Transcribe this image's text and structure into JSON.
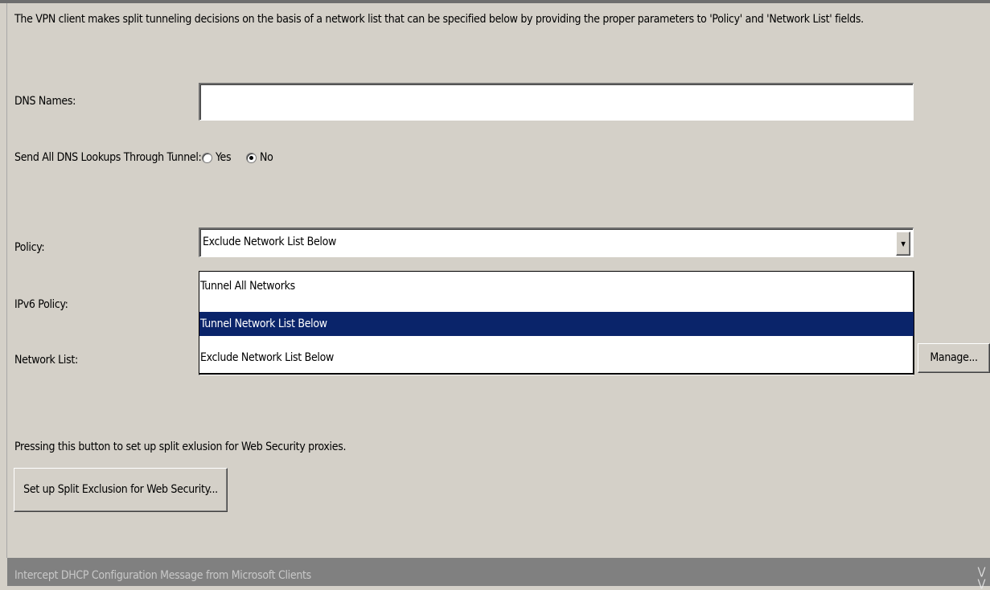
{
  "description": "The VPN client makes split tunneling decisions on the basis of a network list that can be specified below by providing the proper parameters to 'Policy' and 'Network List' fields.",
  "dns_names": {
    "label": "DNS Names:",
    "value": ""
  },
  "send_all_dns": {
    "label": "Send All DNS Lookups Through Tunnel:",
    "options": [
      {
        "label": "Yes",
        "checked": false
      },
      {
        "label": "No",
        "checked": true
      }
    ]
  },
  "policy": {
    "label": "Policy:",
    "value": "Exclude Network List Below",
    "dropdown_open": true,
    "options": [
      "Tunnel All Networks",
      "Tunnel Network List Below",
      "Exclude Network List Below"
    ],
    "highlighted_index": 1
  },
  "ipv6_policy": {
    "label": "IPv6 Policy:"
  },
  "network_list": {
    "label": "Network List:",
    "manage_label": "Manage..."
  },
  "web_security": {
    "description": "Pressing this button to set up split exlusion for Web Security proxies.",
    "button_label": "Set up Split Exclusion for Web Security..."
  },
  "section": {
    "title": "Intercept DHCP Configuration Message from Microsoft Clients",
    "icon": "double-chevron-down-icon"
  },
  "colors": {
    "background": "#d4d0c8",
    "highlight": "#0a246a",
    "section_bar": "#808080"
  }
}
